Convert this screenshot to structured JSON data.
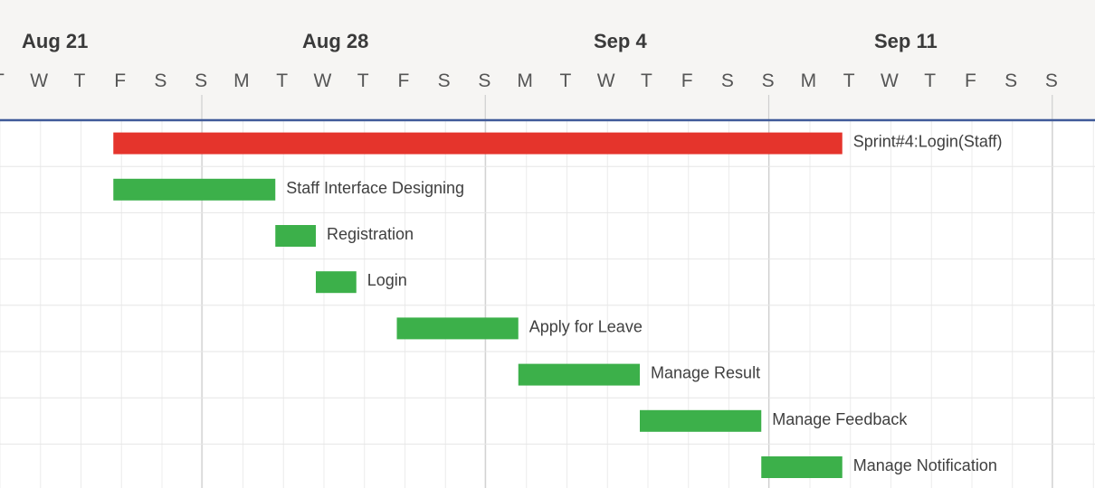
{
  "chart_data": {
    "type": "gantt",
    "title": "",
    "timeline": {
      "start_date": "2023-08-22",
      "end_date": "2023-09-17",
      "weeks": [
        {
          "label": "Aug 21"
        },
        {
          "label": "Aug 28"
        },
        {
          "label": "Sep 4"
        },
        {
          "label": "Sep 11"
        }
      ],
      "day_letters": [
        "T",
        "W",
        "T",
        "F",
        "S",
        "S",
        "M",
        "T",
        "W",
        "T",
        "F",
        "S",
        "S",
        "M",
        "T",
        "W",
        "T",
        "F",
        "S",
        "S",
        "M",
        "T",
        "W",
        "T",
        "F",
        "S",
        "S"
      ]
    },
    "tasks": [
      {
        "name": "Sprint#4:Login(Staff)",
        "start": "2023-08-25",
        "end": "2023-09-11",
        "kind": "sprint"
      },
      {
        "name": "Staff Interface Designing",
        "start": "2023-08-25",
        "end": "2023-08-28",
        "kind": "task"
      },
      {
        "name": "Registration",
        "start": "2023-08-29",
        "end": "2023-08-29",
        "kind": "task"
      },
      {
        "name": "Login",
        "start": "2023-08-30",
        "end": "2023-08-30",
        "kind": "task"
      },
      {
        "name": "Apply for Leave",
        "start": "2023-09-01",
        "end": "2023-09-03",
        "kind": "task"
      },
      {
        "name": "Manage Result",
        "start": "2023-09-04",
        "end": "2023-09-06",
        "kind": "task"
      },
      {
        "name": "Manage Feedback",
        "start": "2023-09-07",
        "end": "2023-09-09",
        "kind": "task"
      },
      {
        "name": "Manage Notification",
        "start": "2023-09-10",
        "end": "2023-09-11",
        "kind": "task"
      }
    ],
    "colors": {
      "sprint_bar": "#e5342c",
      "task_bar": "#3cb04a",
      "header_bg": "#f6f5f3",
      "header_rule": "#3f5a99",
      "minor_grid": "#ececec",
      "week_grid": "#cfcfcf",
      "row_line": "#e6e6e6"
    },
    "grid": true
  }
}
